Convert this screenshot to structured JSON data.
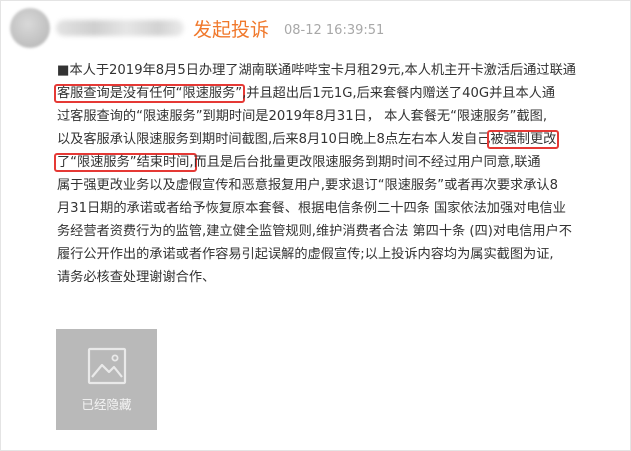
{
  "header": {
    "action": "发起投诉",
    "timestamp": "08-12 16:39:51"
  },
  "complaint": {
    "lines": [
      [
        {
          "t": "■本人于2019年8月5日办理了湖南联通哔哔宝卡月租29元,本人机主开卡激活后通过联通"
        }
      ],
      [
        {
          "t": "客服查询是没有任何“限速服务”",
          "hl": true
        },
        {
          "t": ",并且超出后1元1G,后来套餐内赠送了40G并且本人通"
        }
      ],
      [
        {
          "t": "过客服查询的“限速服务”到期时间是2019年8月31日， 本人套餐无“限速服务”截图,"
        }
      ],
      [
        {
          "t": "以及客服承认限速服务到期时间截图,后来8月10日晚上8点左右本人发自己"
        },
        {
          "t": "被强制更改",
          "hl": true
        }
      ],
      [
        {
          "t": "了“限速服务”结束时间,",
          "hl": true
        },
        {
          "t": "而且是后台批量更改限速服务到期时间不经过用户同意,联通"
        }
      ],
      [
        {
          "t": "属于强更改业务以及虚假宣传和恶意报复用户,要求退订“限速服务”或者再次要求承认8"
        }
      ],
      [
        {
          "t": "月31日期的承诺或者给予恢复原本套餐、根据电信条例二十四条 国家依法加强对电信业"
        }
      ],
      [
        {
          "t": "务经营者资费行为的监管,建立健全监管规则,维护消费者合法 第四十条 (四)对电信用户不"
        }
      ],
      [
        {
          "t": "履行公开作出的承诺或者作容易引起误解的虚假宣传;以上投诉内容均为属实截图为证,"
        }
      ],
      [
        {
          "t": "请务必核查处理谢谢合作、"
        }
      ]
    ]
  },
  "attachment": {
    "label": "已经隐藏",
    "icon": "image-placeholder-icon"
  },
  "colors": {
    "accent": "#f0782b",
    "highlight_border": "#e53935",
    "text": "#333333",
    "timestamp": "#a8a8a8",
    "thumb_bg": "#b9b9b9"
  }
}
